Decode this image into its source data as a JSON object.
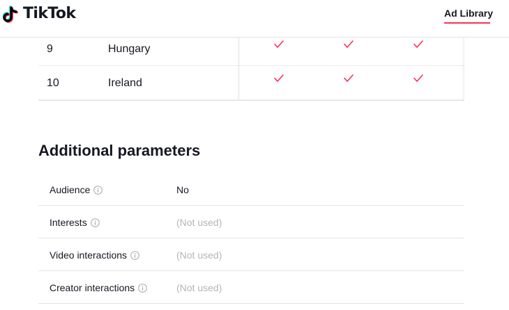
{
  "header": {
    "logo_text": "TikTok",
    "nav_link": "Ad Library",
    "accent_color": "#fe2c55"
  },
  "countries": {
    "rows": [
      {
        "num": "9",
        "name": "Hungary",
        "checks": [
          true,
          true,
          true
        ]
      },
      {
        "num": "10",
        "name": "Ireland",
        "checks": [
          true,
          true,
          true
        ]
      }
    ]
  },
  "additional_parameters": {
    "title": "Additional parameters",
    "rows": [
      {
        "label": "Audience",
        "value": "No",
        "muted": false,
        "icon": "info-icon"
      },
      {
        "label": "Interests",
        "value": "(Not used)",
        "muted": true,
        "icon": "info-icon"
      },
      {
        "label": "Video interactions",
        "value": "(Not used)",
        "muted": true,
        "icon": "info-icon"
      },
      {
        "label": "Creator interactions",
        "value": "(Not used)",
        "muted": true,
        "icon": "info-icon"
      }
    ]
  }
}
